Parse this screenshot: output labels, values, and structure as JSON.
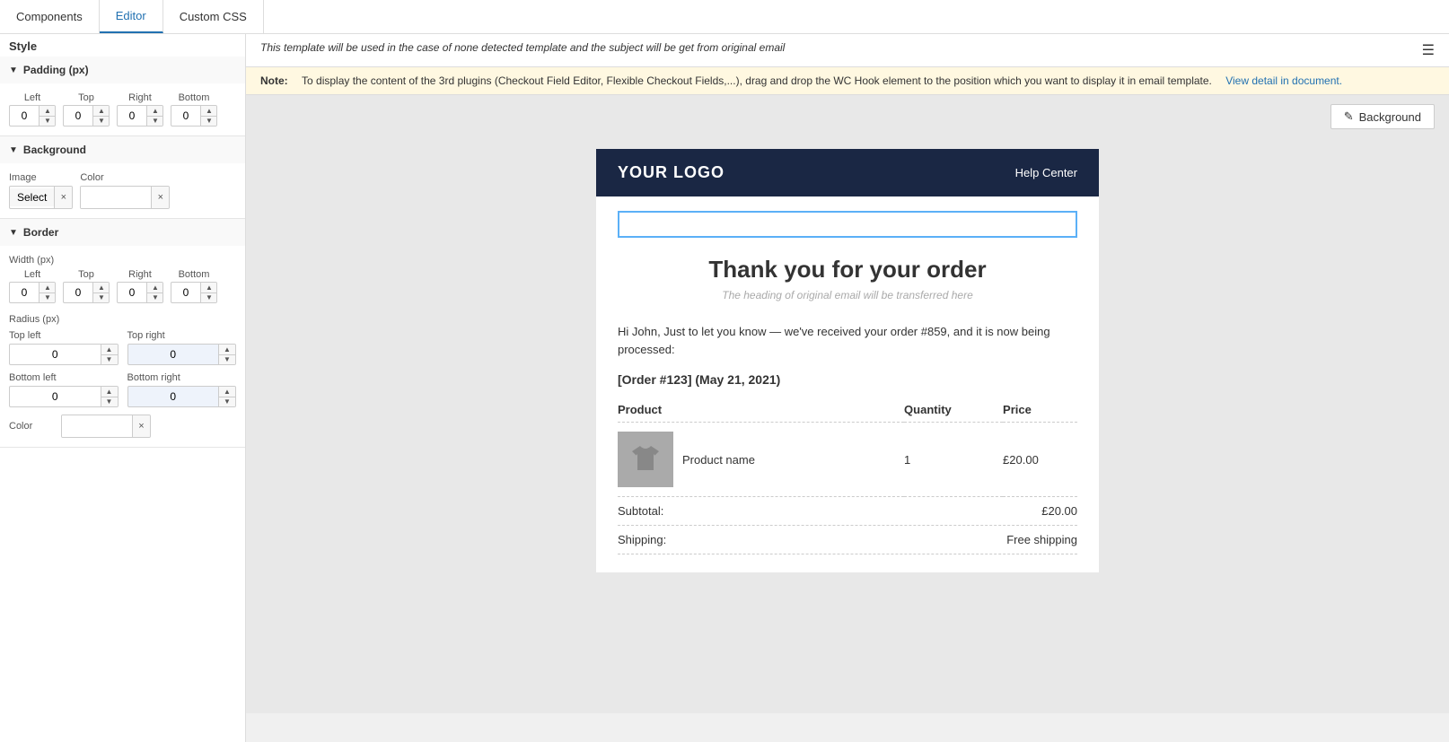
{
  "tabs": [
    {
      "id": "components",
      "label": "Components",
      "active": false
    },
    {
      "id": "editor",
      "label": "Editor",
      "active": true
    },
    {
      "id": "custom-css",
      "label": "Custom CSS",
      "active": false
    }
  ],
  "top_notice": "This template will be used in the case of none detected template and the subject will be get from original email",
  "note_label": "Note:",
  "note_text": "To display the content of the 3rd plugins (Checkout Field Editor, Flexible Checkout Fields,...), drag and drop the WC Hook element to the position which you want to display it in email template.",
  "note_link_text": "View detail in document.",
  "style_section": {
    "label": "Style"
  },
  "padding_section": {
    "header": "Padding (px)",
    "left_label": "Left",
    "top_label": "Top",
    "right_label": "Right",
    "bottom_label": "Bottom",
    "left_value": "0",
    "top_value": "0",
    "right_value": "0",
    "bottom_value": "0"
  },
  "background_section": {
    "header": "Background",
    "image_label": "Image",
    "color_label": "Color",
    "select_btn": "Select",
    "clear_icon": "×"
  },
  "border_section": {
    "header": "Border",
    "width_label": "Width (px)",
    "left_label": "Left",
    "top_label": "Top",
    "right_label": "Right",
    "bottom_label": "Bottom",
    "left_value": "0",
    "top_value": "0",
    "right_value": "0",
    "bottom_value": "0",
    "radius_label": "Radius (px)",
    "top_left_label": "Top left",
    "top_right_label": "Top right",
    "bottom_left_label": "Bottom left",
    "bottom_right_label": "Bottom right",
    "top_left_value": "0",
    "top_right_value": "0",
    "bottom_left_value": "0",
    "bottom_right_value": "0",
    "color_label": "Color"
  },
  "background_btn": {
    "label": "Background",
    "icon": "✎"
  },
  "email_preview": {
    "logo": "YOUR LOGO",
    "help_center": "Help Center",
    "title": "Thank you for your order",
    "subtitle": "The heading of original email will be transferred here",
    "greeting": "Hi John, Just to let you know — we've received your order #859, and it is now being processed:",
    "order_ref": "[Order #123] (May 21, 2021)",
    "table": {
      "col_product": "Product",
      "col_quantity": "Quantity",
      "col_price": "Price",
      "rows": [
        {
          "name": "Product name",
          "quantity": "1",
          "price": "£20.00"
        }
      ]
    },
    "summary": [
      {
        "label": "Subtotal:",
        "value": "£20.00"
      },
      {
        "label": "Shipping:",
        "value": "Free shipping"
      }
    ]
  }
}
